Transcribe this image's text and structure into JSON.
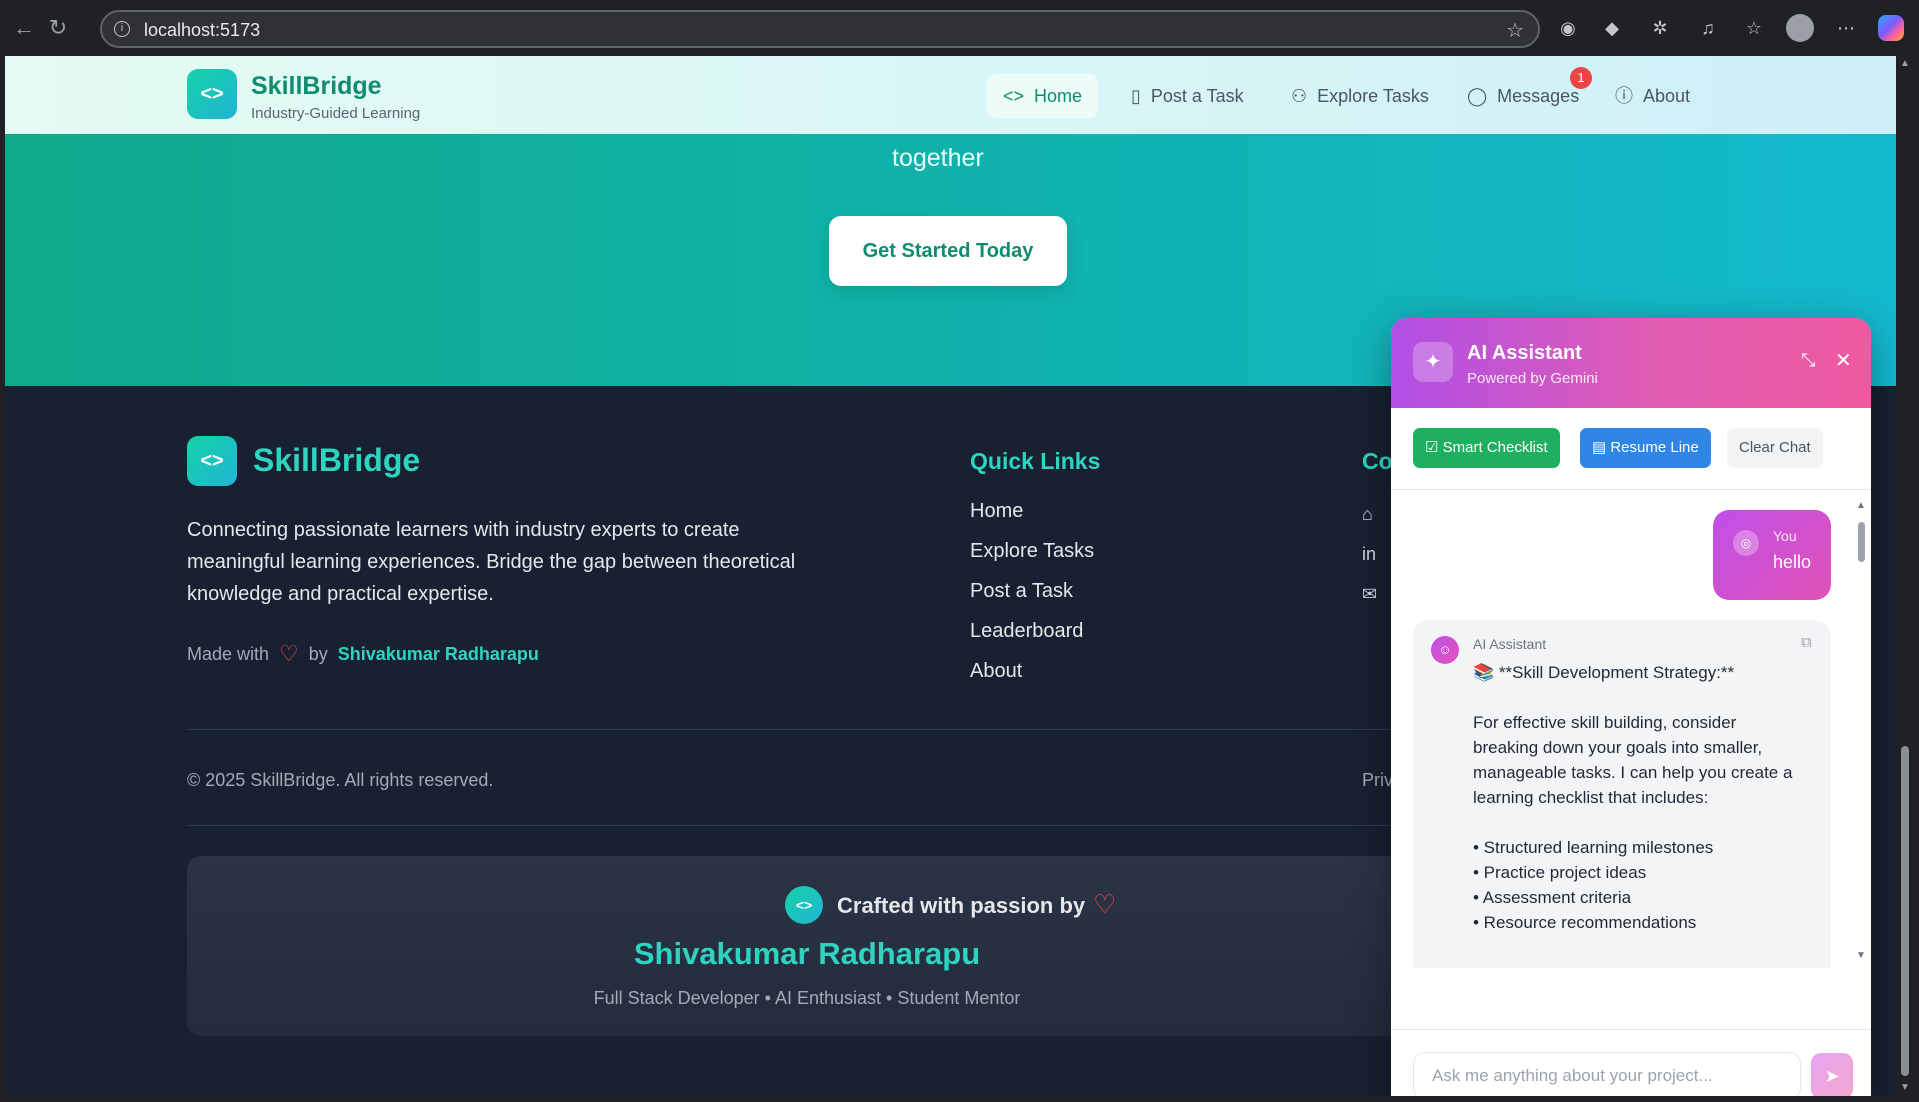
{
  "browser": {
    "url": "localhost:5173",
    "back_icon": "arrow-left-icon",
    "reload_icon": "reload-icon"
  },
  "nav": {
    "brand_name": "SkillBridge",
    "brand_tagline": "Industry-Guided Learning",
    "items": [
      {
        "label": "Home",
        "icon": "code-icon"
      },
      {
        "label": "Post a Task",
        "icon": "book-icon"
      },
      {
        "label": "Explore Tasks",
        "icon": "users-icon"
      },
      {
        "label": "Messages",
        "icon": "chat-icon"
      },
      {
        "label": "About",
        "icon": "info-icon"
      }
    ],
    "messages_badge": "1"
  },
  "hero": {
    "tagline_tail": "together",
    "cta_label": "Get Started Today"
  },
  "footer": {
    "brand_name": "SkillBridge",
    "description": "Connecting passionate learners with industry experts to create meaningful learning experiences. Bridge the gap between theoretical knowledge and practical expertise.",
    "made_with": "Made with",
    "by": "by",
    "author": "Shivakumar Radharapu",
    "quick_links_title": "Quick Links",
    "quick_links": [
      "Home",
      "Explore Tasks",
      "Post a Task",
      "Leaderboard",
      "About"
    ],
    "connect_title_partial": "Co",
    "copyright": "© 2025 SkillBridge. All rights reserved.",
    "privacy_partial": "Priv",
    "crafted_text": "Crafted with passion by",
    "crafted_name": "Shivakumar Radharapu",
    "crafted_role": "Full Stack Developer • AI Enthusiast • Student Mentor"
  },
  "ai_panel": {
    "title": "AI Assistant",
    "subtitle": "Powered by Gemini",
    "actions": {
      "smart_checklist": "Smart Checklist",
      "resume_line": "Resume Line",
      "clear_chat": "Clear Chat"
    },
    "user_message": {
      "who": "You",
      "text": "hello"
    },
    "bot_message": {
      "who": "AI Assistant",
      "heading": "📚 **Skill Development Strategy:**",
      "body": "For effective skill building, consider breaking down your goals into smaller, manageable tasks. I can help you create a learning checklist that includes:\n\n• Structured learning milestones\n• Practice project ideas\n• Assessment criteria\n• Resource recommendations"
    },
    "input_placeholder": "Ask me anything about your project..."
  }
}
